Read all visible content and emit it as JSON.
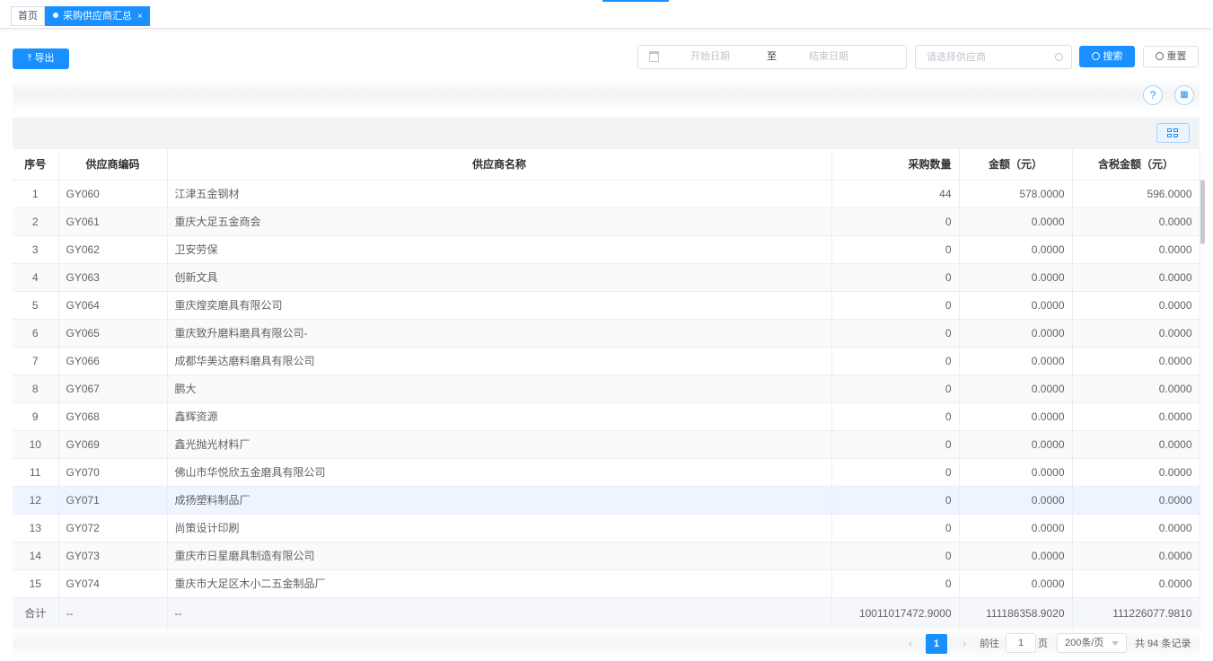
{
  "tabs": [
    {
      "label": "首页"
    },
    {
      "label": "采购供应商汇总",
      "close": "×"
    }
  ],
  "toolbar": {
    "export_label": "导出",
    "export_icon": "⤒",
    "date_start_placeholder": "开始日期",
    "date_separator": "至",
    "date_end_placeholder": "结束日期",
    "supplier_placeholder": "请选择供应商",
    "search_label": "搜索",
    "reset_label": "重置"
  },
  "right_tools": {
    "help": "?",
    "columns": "▦"
  },
  "table": {
    "headers": [
      "序号",
      "供应商编码",
      "供应商名称",
      "采购数量",
      "金额（元）",
      "含税金额（元）"
    ],
    "rows": [
      [
        "1",
        "GY060",
        "江津五金钢材",
        "44",
        "578.0000",
        "596.0000"
      ],
      [
        "2",
        "GY061",
        "重庆大足五金商会",
        "0",
        "0.0000",
        "0.0000"
      ],
      [
        "3",
        "GY062",
        "卫安劳保",
        "0",
        "0.0000",
        "0.0000"
      ],
      [
        "4",
        "GY063",
        "创新文具",
        "0",
        "0.0000",
        "0.0000"
      ],
      [
        "5",
        "GY064",
        "重庆煌奕磨具有限公司",
        "0",
        "0.0000",
        "0.0000"
      ],
      [
        "6",
        "GY065",
        "重庆致升磨料磨具有限公司-",
        "0",
        "0.0000",
        "0.0000"
      ],
      [
        "7",
        "GY066",
        "成都华美达磨料磨具有限公司",
        "0",
        "0.0000",
        "0.0000"
      ],
      [
        "8",
        "GY067",
        "鹏大",
        "0",
        "0.0000",
        "0.0000"
      ],
      [
        "9",
        "GY068",
        "鑫辉资源",
        "0",
        "0.0000",
        "0.0000"
      ],
      [
        "10",
        "GY069",
        "鑫光抛光材料厂",
        "0",
        "0.0000",
        "0.0000"
      ],
      [
        "11",
        "GY070",
        "佛山市华悦欣五金磨具有限公司",
        "0",
        "0.0000",
        "0.0000"
      ],
      [
        "12",
        "GY071",
        "成扬塑料制品厂",
        "0",
        "0.0000",
        "0.0000"
      ],
      [
        "13",
        "GY072",
        "尚策设计印刷",
        "0",
        "0.0000",
        "0.0000"
      ],
      [
        "14",
        "GY073",
        "重庆市日星磨具制造有限公司",
        "0",
        "0.0000",
        "0.0000"
      ],
      [
        "15",
        "GY074",
        "重庆市大足区木小二五金制品厂",
        "0",
        "0.0000",
        "0.0000"
      ]
    ],
    "total": [
      "合计",
      "--",
      "--",
      "10011017472.9000",
      "111186358.9020",
      "111226077.9810"
    ],
    "highlighted_row": 12
  },
  "pagination": {
    "prev": "‹",
    "current_page": "1",
    "next": "›",
    "goto_label": "前往",
    "goto_value": "1",
    "page_unit": "页",
    "page_size": "200条/页",
    "total_text": "共 94 条记录"
  },
  "colors": {
    "primary": "#1890ff",
    "highlight_row": "#eef5fe"
  }
}
